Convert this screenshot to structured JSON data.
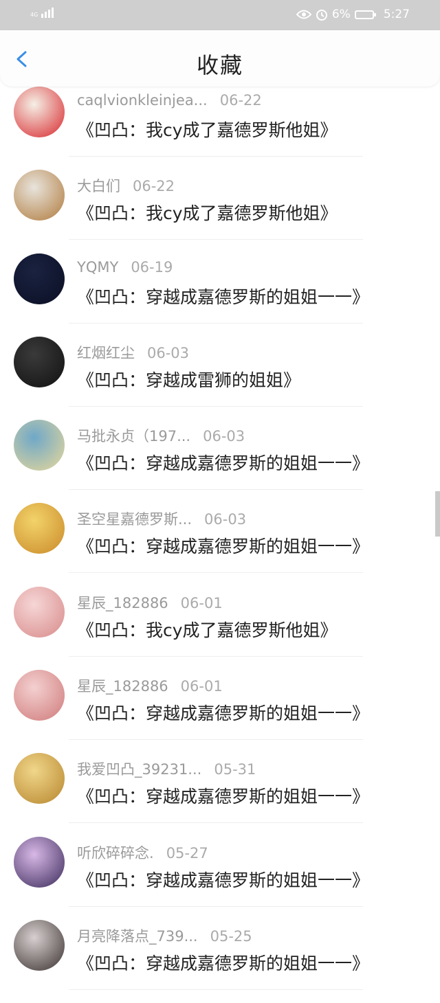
{
  "status_bar": {
    "network": "4G",
    "battery_percent": "6%",
    "time": "5:27"
  },
  "header": {
    "title": "收藏"
  },
  "items": [
    {
      "user": "caqlvionkleinjea...",
      "date": "06-22",
      "title": "《凹凸：我cy成了嘉德罗斯他姐》",
      "avatar_colors": [
        "#f5f0e6",
        "#d8262c"
      ]
    },
    {
      "user": "大白们",
      "date": "06-22",
      "title": "《凹凸：我cy成了嘉德罗斯他姐》",
      "avatar_colors": [
        "#e8e4dc",
        "#b07a3c"
      ]
    },
    {
      "user": "YQMY",
      "date": "06-19",
      "title": "《凹凸：穿越成嘉德罗斯的姐姐一一》",
      "avatar_colors": [
        "#1a2240",
        "#0b0f24"
      ]
    },
    {
      "user": "红烟红尘",
      "date": "06-03",
      "title": "《凹凸：穿越成雷狮的姐姐》",
      "avatar_colors": [
        "#3a3a3a",
        "#111111"
      ]
    },
    {
      "user": "马批永贞（197...",
      "date": "06-03",
      "title": "《凹凸：穿越成嘉德罗斯的姐姐一一》",
      "avatar_colors": [
        "#6fa8c8",
        "#e8d89a"
      ]
    },
    {
      "user": "圣空星嘉德罗斯...",
      "date": "06-03",
      "title": "《凹凸：穿越成嘉德罗斯的姐姐一一》",
      "avatar_colors": [
        "#f3d36a",
        "#c98a2a"
      ]
    },
    {
      "user": "星辰_182886",
      "date": "06-01",
      "title": "《凹凸：我cy成了嘉德罗斯他姐》",
      "avatar_colors": [
        "#f6d6d6",
        "#d88a8a"
      ]
    },
    {
      "user": "星辰_182886",
      "date": "06-01",
      "title": "《凹凸：穿越成嘉德罗斯的姐姐一一》",
      "avatar_colors": [
        "#f4d0d0",
        "#cf7a7a"
      ]
    },
    {
      "user": "我爱凹凸_39231...",
      "date": "05-31",
      "title": "《凹凸：穿越成嘉德罗斯的姐姐一一》",
      "avatar_colors": [
        "#f0d68a",
        "#b7862e"
      ]
    },
    {
      "user": "听欣碎碎念.",
      "date": "05-27",
      "title": "《凹凸：穿越成嘉德罗斯的姐姐一一》",
      "avatar_colors": [
        "#d8b8e6",
        "#3a2a5a"
      ]
    },
    {
      "user": "月亮降落点_739...",
      "date": "05-25",
      "title": "《凹凸：穿越成嘉德罗斯的姐姐一一》",
      "avatar_colors": [
        "#d8d0d0",
        "#3a3030"
      ]
    }
  ],
  "colors": {
    "accent": "#3a8ee6",
    "status_bar_bg": "#cfcfcf",
    "meta_text": "#9a9a9a",
    "title_text": "#222222"
  }
}
